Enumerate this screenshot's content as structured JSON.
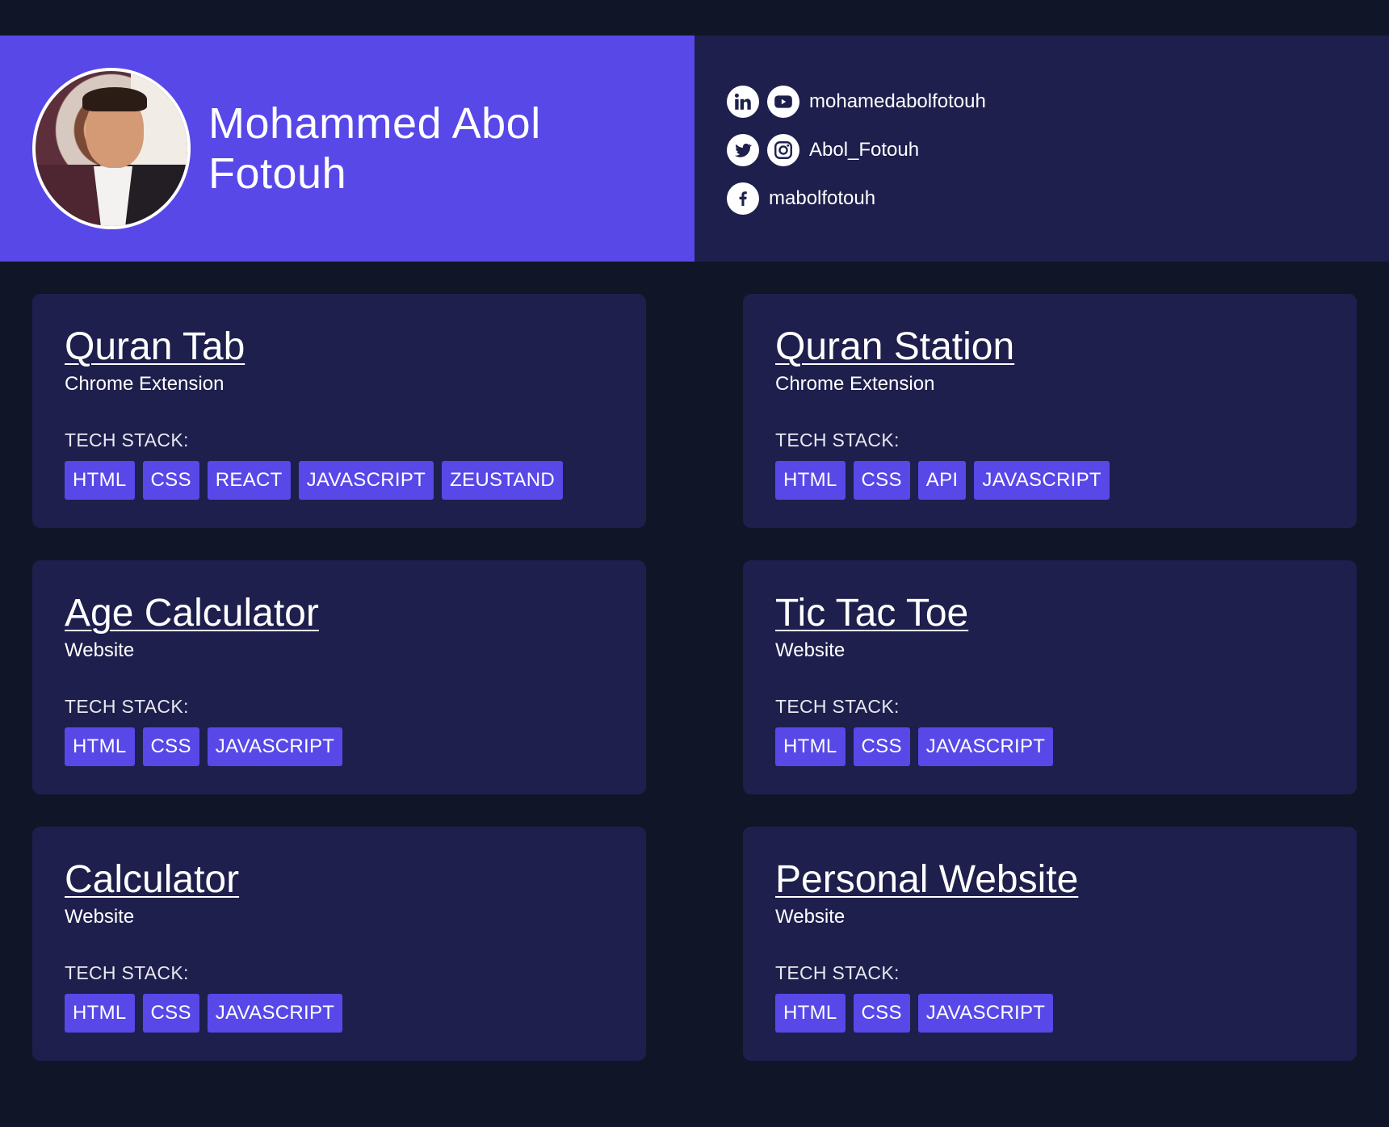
{
  "profile": {
    "name": "Mohammed Abol Fotouh",
    "avatar": "profile-photo"
  },
  "socials": [
    {
      "icons": [
        "linkedin-icon",
        "youtube-icon"
      ],
      "handle": "mohamedabolfotouh"
    },
    {
      "icons": [
        "twitter-icon",
        "instagram-icon"
      ],
      "handle": "Abol_Fotouh"
    },
    {
      "icons": [
        "facebook-icon"
      ],
      "handle": "mabolfotouh"
    }
  ],
  "tech_label": "TECH STACK:",
  "projects": [
    {
      "title": "Quran Tab",
      "type": "Chrome Extension",
      "stack": [
        "HTML",
        "CSS",
        "REACT",
        "JAVASCRIPT",
        "ZEUSTAND"
      ]
    },
    {
      "title": "Quran Station",
      "type": "Chrome Extension",
      "stack": [
        "HTML",
        "CSS",
        "API",
        "JAVASCRIPT"
      ]
    },
    {
      "title": "Age Calculator",
      "type": "Website",
      "stack": [
        "HTML",
        "CSS",
        "JAVASCRIPT"
      ]
    },
    {
      "title": "Tic Tac Toe",
      "type": "Website",
      "stack": [
        "HTML",
        "CSS",
        "JAVASCRIPT"
      ]
    },
    {
      "title": "Calculator",
      "type": "Website",
      "stack": [
        "HTML",
        "CSS",
        "JAVASCRIPT"
      ]
    },
    {
      "title": "Personal Website",
      "type": "Website",
      "stack": [
        "HTML",
        "CSS",
        "JAVASCRIPT"
      ]
    }
  ],
  "colors": {
    "background": "#101627",
    "accent": "#5848e8",
    "panel": "#1e1f4c",
    "text": "#ffffff"
  }
}
